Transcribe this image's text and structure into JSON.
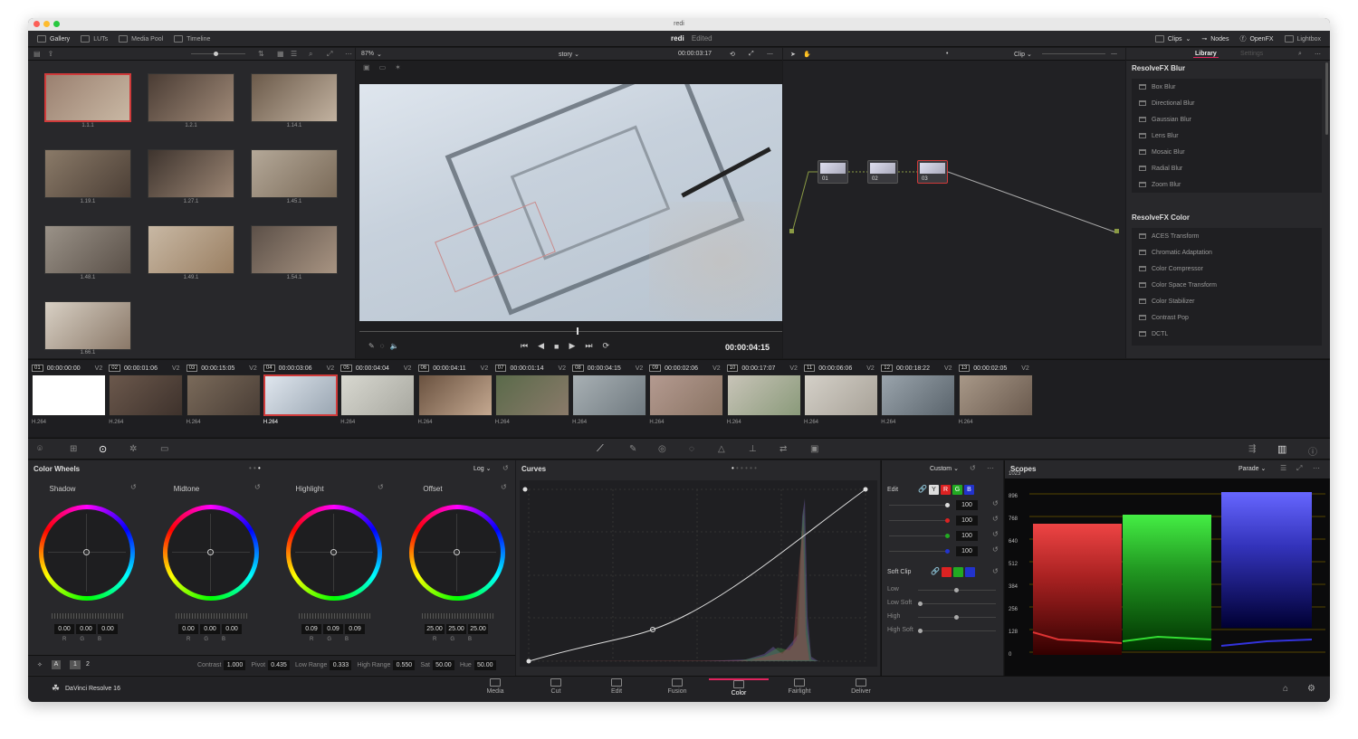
{
  "app": {
    "window_title": "redi",
    "project_name": "redi",
    "project_status": "Edited",
    "brand": "DaVinci Resolve 16"
  },
  "top_toolbar": {
    "left": [
      "Gallery",
      "LUTs",
      "Media Pool",
      "Timeline"
    ],
    "right": [
      "Clips",
      "Nodes",
      "OpenFX",
      "Lightbox"
    ]
  },
  "viewer": {
    "zoom": "87%",
    "timeline_name": "story",
    "timecode_top": "00:00:03:17",
    "timecode_bottom": "00:00:04:15"
  },
  "gallery": {
    "stills": [
      "1.1.1",
      "1.2.1",
      "1.14.1",
      "1.19.1",
      "1.27.1",
      "1.45.1",
      "1.48.1",
      "1.49.1",
      "1.54.1",
      "1.66.1"
    ]
  },
  "node_editor": {
    "mode": "Clip",
    "nodes": [
      "01",
      "02",
      "03"
    ]
  },
  "library": {
    "tabs": [
      "Library",
      "Settings"
    ],
    "groups": [
      {
        "title": "ResolveFX Blur",
        "items": [
          "Box Blur",
          "Directional Blur",
          "Gaussian Blur",
          "Lens Blur",
          "Mosaic Blur",
          "Radial Blur",
          "Zoom Blur"
        ]
      },
      {
        "title": "ResolveFX Color",
        "items": [
          "ACES Transform",
          "Chromatic Adaptation",
          "Color Compressor",
          "Color Space Transform",
          "Color Stabilizer",
          "Contrast Pop",
          "DCTL"
        ]
      }
    ]
  },
  "timeline": {
    "clips": [
      {
        "num": "01",
        "tc": "00:00:00:00",
        "track": "V2",
        "codec": "H.264"
      },
      {
        "num": "02",
        "tc": "00:00:01:06",
        "track": "V2",
        "codec": "H.264"
      },
      {
        "num": "03",
        "tc": "00:00:15:05",
        "track": "V2",
        "codec": "H.264"
      },
      {
        "num": "04",
        "tc": "00:00:03:06",
        "track": "V2",
        "codec": "H.264"
      },
      {
        "num": "05",
        "tc": "00:00:04:04",
        "track": "V2",
        "codec": "H.264"
      },
      {
        "num": "06",
        "tc": "00:00:04:11",
        "track": "V2",
        "codec": "H.264"
      },
      {
        "num": "07",
        "tc": "00:00:01:14",
        "track": "V2",
        "codec": "H.264"
      },
      {
        "num": "08",
        "tc": "00:00:04:15",
        "track": "V2",
        "codec": "H.264"
      },
      {
        "num": "09",
        "tc": "00:00:02:06",
        "track": "V2",
        "codec": "H.264"
      },
      {
        "num": "10",
        "tc": "00:00:17:07",
        "track": "V2",
        "codec": "H.264"
      },
      {
        "num": "11",
        "tc": "00:00:06:06",
        "track": "V2",
        "codec": "H.264"
      },
      {
        "num": "12",
        "tc": "00:00:18:22",
        "track": "V2",
        "codec": "H.264"
      },
      {
        "num": "13",
        "tc": "00:00:02:05",
        "track": "V2",
        "codec": "H.264"
      }
    ]
  },
  "color_wheels": {
    "title": "Color Wheels",
    "mode": "Log",
    "wheels": [
      {
        "name": "Shadow",
        "values": [
          "0.00",
          "0.00",
          "0.00"
        ]
      },
      {
        "name": "Midtone",
        "values": [
          "0.00",
          "0.00",
          "0.00"
        ]
      },
      {
        "name": "Highlight",
        "values": [
          "0.09",
          "0.09",
          "0.09"
        ]
      },
      {
        "name": "Offset",
        "values": [
          "25.00",
          "25.00",
          "25.00"
        ]
      }
    ],
    "channel_labels": [
      "R",
      "G",
      "B"
    ],
    "pages": [
      "1",
      "2"
    ],
    "params": [
      {
        "label": "Contrast",
        "value": "1.000"
      },
      {
        "label": "Pivot",
        "value": "0.435"
      },
      {
        "label": "Low Range",
        "value": "0.333"
      },
      {
        "label": "High Range",
        "value": "0.550"
      },
      {
        "label": "Sat",
        "value": "50.00"
      },
      {
        "label": "Hue",
        "value": "50.00"
      }
    ]
  },
  "curves": {
    "title": "Curves",
    "mode": "Custom",
    "edit_label": "Edit",
    "channels": [
      "Y",
      "R",
      "G",
      "B"
    ],
    "intensities": [
      "100",
      "100",
      "100",
      "100"
    ],
    "soft_clip": {
      "title": "Soft Clip",
      "rows": [
        "Low",
        "Low Soft",
        "High",
        "High Soft"
      ]
    }
  },
  "scopes": {
    "title": "Scopes",
    "mode": "Parade",
    "ticks": [
      "1023",
      "896",
      "768",
      "640",
      "512",
      "384",
      "256",
      "128",
      "0"
    ]
  },
  "pages": [
    "Media",
    "Cut",
    "Edit",
    "Fusion",
    "Color",
    "Fairlight",
    "Deliver"
  ],
  "active_page": "Color",
  "colors": {
    "accent": "#e0245e",
    "selection": "#cf3a3a"
  }
}
